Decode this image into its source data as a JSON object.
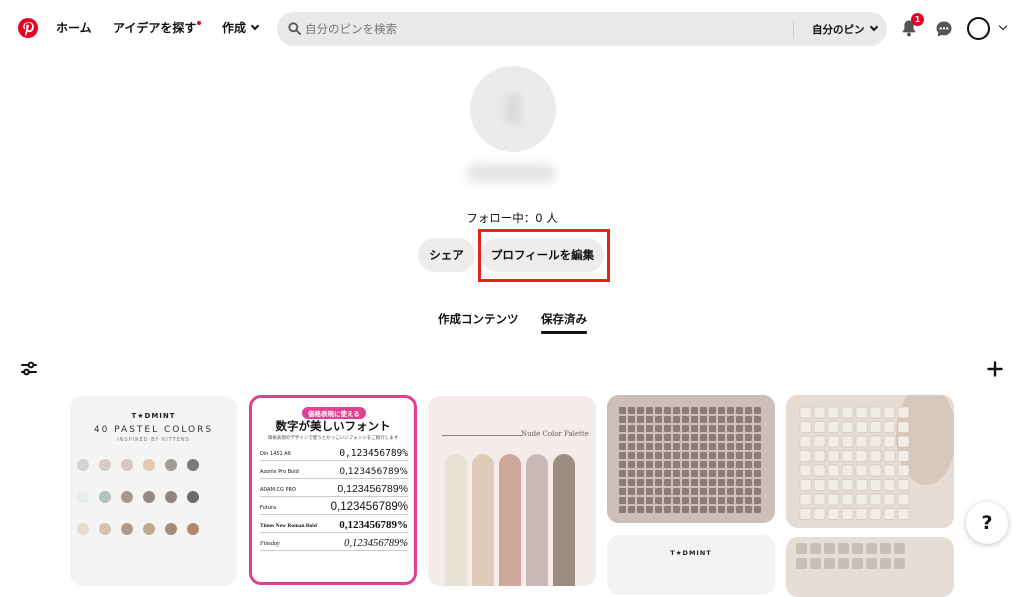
{
  "header": {
    "logo": "pinterest-logo",
    "nav": {
      "home": "ホーム",
      "ideas": "アイデアを探す",
      "create": "作成"
    },
    "search": {
      "placeholder": "自分のピンを検索",
      "scope": "自分のピン"
    },
    "notifications_count": "1",
    "icons": [
      "search-icon",
      "bell-icon",
      "chat-icon",
      "account-icon",
      "chevron-down-icon"
    ]
  },
  "profile": {
    "following": "フォロー中：0 人",
    "share_label": "シェア",
    "edit_label": "プロフィールを編集"
  },
  "tabs": {
    "created": "作成コンテンツ",
    "saved": "保存済み"
  },
  "pins": {
    "pastel": {
      "brand": "T★DMINT",
      "title": "40 PASTEL COLORS",
      "subtitle": "INSPIRED BY KITTENS",
      "swatch_colors": [
        "#d4d3d1",
        "#d7ccc9",
        "#d4c7c2",
        "#e5c8b0",
        "#a19b98",
        "#7b7b7b",
        "#e6ece8",
        "#b4c3bb",
        "#a49891",
        "#958a85",
        "#8e8682",
        "#6d6b6b",
        "#e5ddd2",
        "#d4c3b0",
        "#ac9a8c",
        "#bfa98b",
        "#9f8e80",
        "#b6876f"
      ]
    },
    "fonts": {
      "tag": "価格表現に使える",
      "title": "数字が美しいフォント",
      "subtitle": "価格表現のデザインで使うとかっこいいフォントをご紹介します",
      "rows": [
        {
          "name": "Din 1451 Alt",
          "value": "0,123456789%"
        },
        {
          "name": "Azonix Pro Bold",
          "value": "0,123456789%"
        },
        {
          "name": "ADAM.CG PRO",
          "value": "0,123456789%"
        },
        {
          "name": "Futura",
          "value": "0,123456789%"
        },
        {
          "name": "Times New Roman Bold",
          "value": "0,123456789%"
        },
        {
          "name": "Fineday",
          "value": "0,123456789%"
        }
      ]
    },
    "nude": {
      "title": "Nude Color Palette",
      "bar_colors": [
        "#e7e1d6",
        "#ddccb7",
        "#cda89a",
        "#c8b9b6",
        "#9d8c82"
      ]
    },
    "tadmint2": {
      "brand": "T★DMINT"
    }
  },
  "help_label": "?"
}
